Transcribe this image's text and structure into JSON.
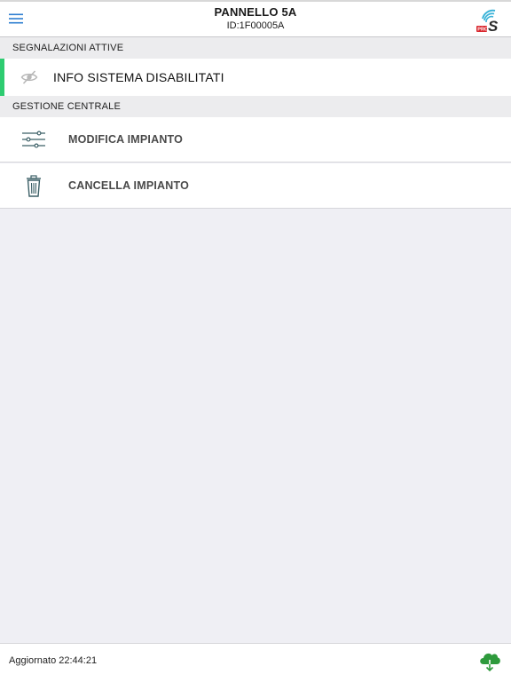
{
  "header": {
    "menu_icon": "hamburger-menu-icon",
    "title": "PANNELLO 5A",
    "subtitle": "ID:1F00005A",
    "logo_icon": "pro-s-wireless-logo",
    "logo_text": "PRO",
    "colors": {
      "menu": "#2f7fd1",
      "logo_dark": "#2b2b2b",
      "logo_wave": "#3bb3d8",
      "logo_red": "#d9272e"
    }
  },
  "active_alerts": {
    "section_title": "SEGNALAZIONI ATTIVE",
    "items": [
      {
        "label": "INFO SISTEMA DISABILITATI",
        "icon": "eye-slash-icon",
        "indicator_color": "#2ecc71"
      }
    ]
  },
  "central_management": {
    "section_title": "GESTIONE CENTRALE",
    "items": [
      {
        "label": "MODIFICA IMPIANTO",
        "icon": "sliders-icon"
      },
      {
        "label": "CANCELLA IMPIANTO",
        "icon": "trash-icon"
      }
    ]
  },
  "footer": {
    "updated_text": "Aggiornato 22:44:21",
    "cloud_icon": "cloud-download-icon",
    "cloud_color": "#2e9a3c"
  }
}
